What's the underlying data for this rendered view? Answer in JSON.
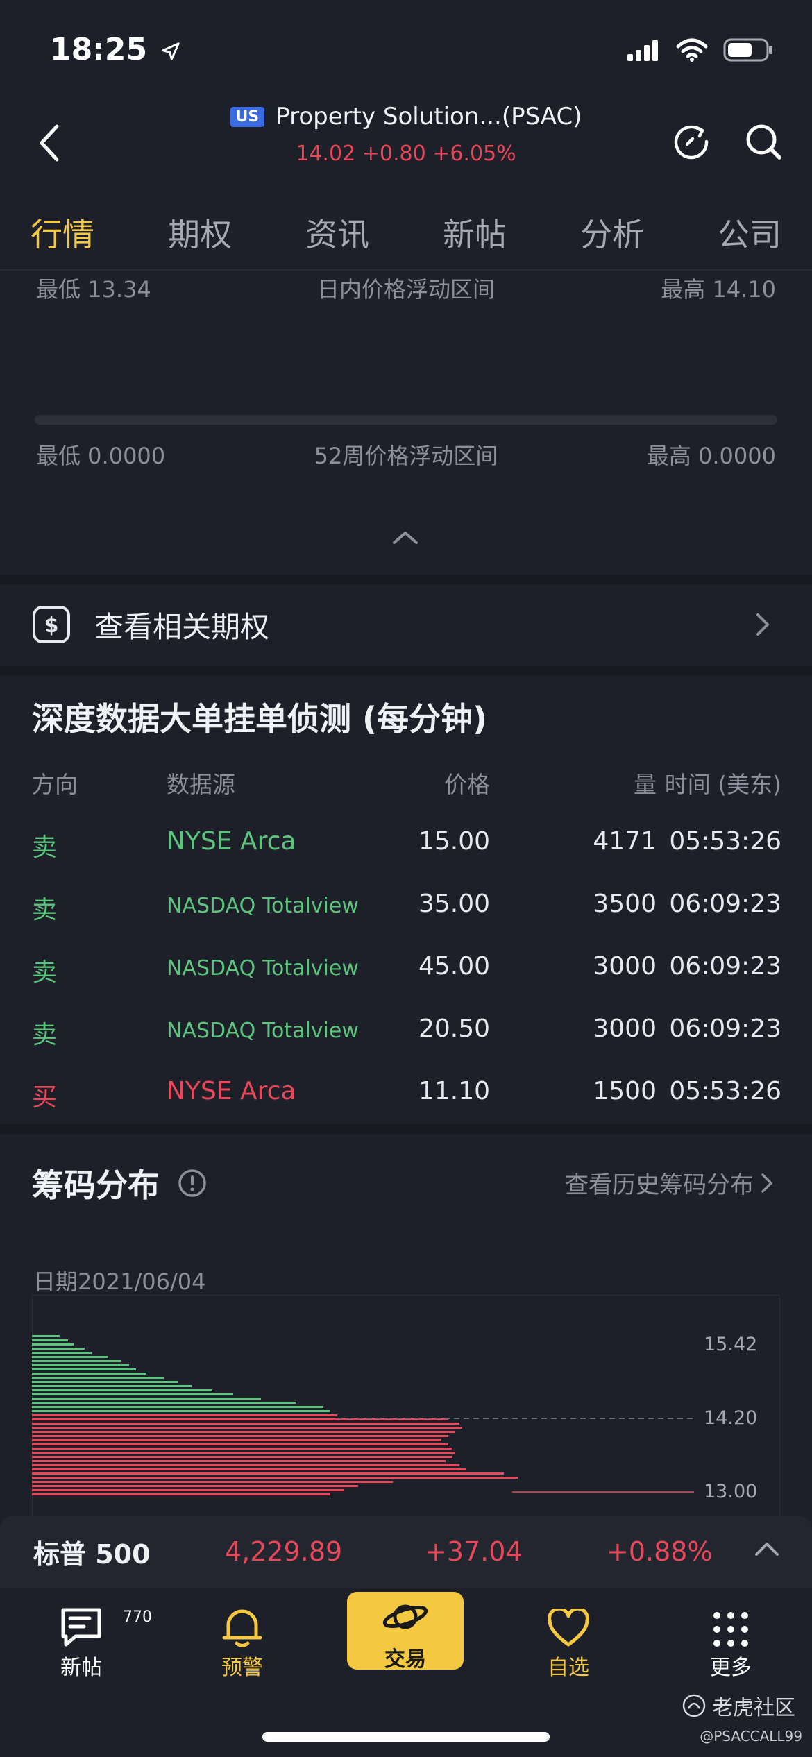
{
  "status": {
    "time": "18:25"
  },
  "header": {
    "market_badge": "US",
    "title": "Property Solution...(PSAC)",
    "price": "14.02",
    "change": "+0.80",
    "change_pct": "+6.05%"
  },
  "tabs": [
    "行情",
    "期权",
    "资讯",
    "新帖",
    "分析",
    "公司"
  ],
  "intraday": {
    "low": "最低 13.34",
    "label": "日内价格浮动区间",
    "high": "最高 14.10"
  },
  "week52": {
    "low": "最低 0.0000",
    "label": "52周价格浮动区间",
    "high": "最高 0.0000"
  },
  "options_link": {
    "label": "查看相关期权"
  },
  "depth": {
    "title": "深度数据大单挂单侦测 (每分钟)",
    "columns": {
      "direction": "方向",
      "source": "数据源",
      "price": "价格",
      "volume": "量",
      "time": "时间 (美东)"
    },
    "rows": [
      {
        "direction": "卖",
        "source": "NYSE Arca",
        "price": "15.00",
        "volume": "4171",
        "time": "05:53:26"
      },
      {
        "direction": "卖",
        "source": "NASDAQ Totalview",
        "price": "35.00",
        "volume": "3500",
        "time": "06:09:23"
      },
      {
        "direction": "卖",
        "source": "NASDAQ Totalview",
        "price": "45.00",
        "volume": "3000",
        "time": "06:09:23"
      },
      {
        "direction": "卖",
        "source": "NASDAQ Totalview",
        "price": "20.50",
        "volume": "3000",
        "time": "06:09:23"
      },
      {
        "direction": "买",
        "source": "NYSE Arca",
        "price": "11.10",
        "volume": "1500",
        "time": "05:53:26"
      }
    ]
  },
  "chips": {
    "title": "筹码分布",
    "history_link": "查看历史筹码分布",
    "date": "日期2021/06/04",
    "price_labels": [
      "15.42",
      "14.20",
      "13.00"
    ]
  },
  "index_bar": {
    "name": "标普 500",
    "value": "4,229.89",
    "change": "+37.04",
    "change_pct": "+0.88%"
  },
  "nav": {
    "posts": "新帖",
    "posts_badge": "770",
    "alerts": "预警",
    "trade": "交易",
    "watchlist": "自选",
    "more": "更多"
  },
  "watermark": {
    "brand": "老虎社区",
    "handle": "@PSACCALL99"
  },
  "colors": {
    "up": "#e8485a",
    "down": "#5bc47d",
    "accent": "#f5c842",
    "background": "#1e2029"
  }
}
